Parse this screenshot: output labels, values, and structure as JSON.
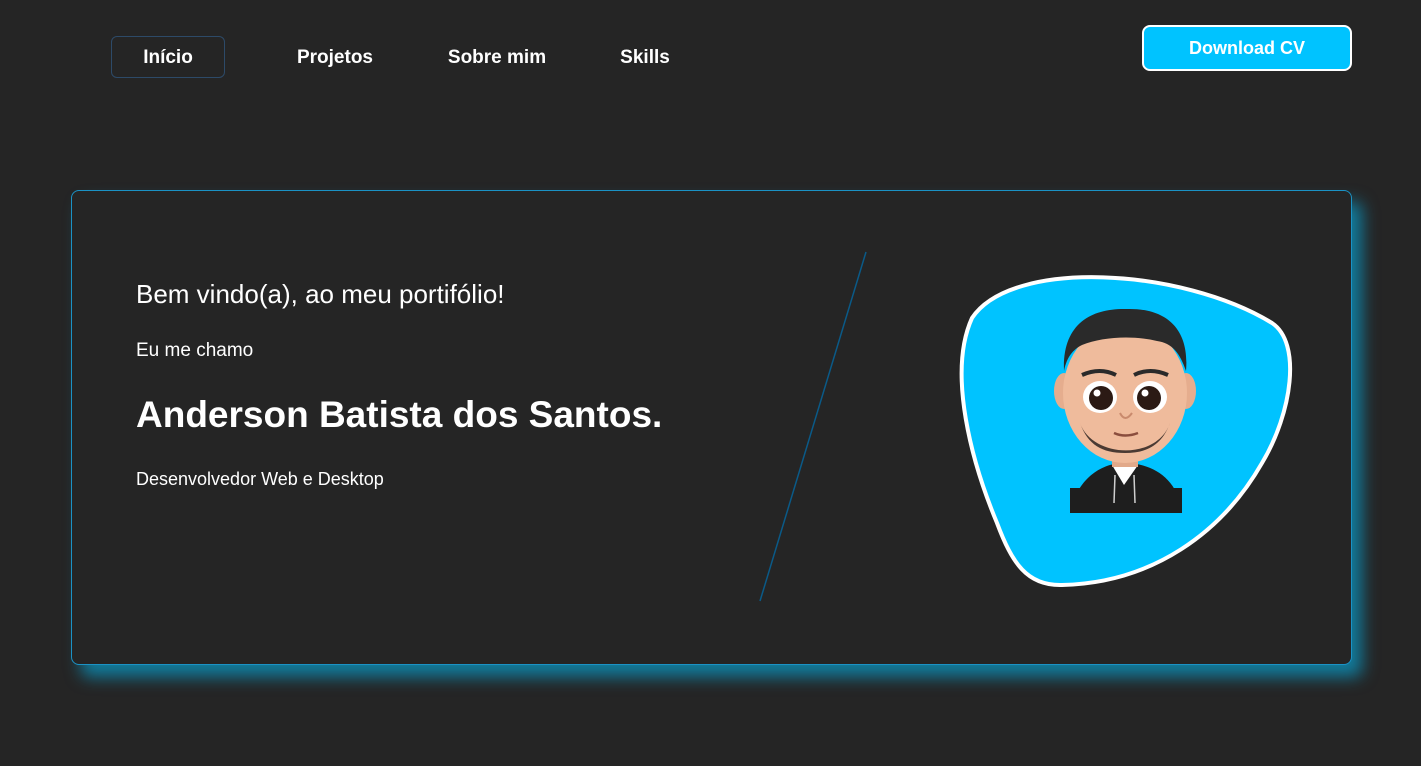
{
  "nav": {
    "items": [
      {
        "label": "Início",
        "active": true
      },
      {
        "label": "Projetos",
        "active": false
      },
      {
        "label": "Sobre mim",
        "active": false
      },
      {
        "label": "Skills",
        "active": false
      }
    ],
    "download_label": "Download CV"
  },
  "hero": {
    "greeting": "Bem vindo(a), ao meu portifólio!",
    "intro": "Eu me chamo",
    "name": "Anderson Batista dos Santos.",
    "role": "Desenvolvedor Web e Desktop",
    "avatar_icon": "avatar-illustration-icon"
  },
  "colors": {
    "background": "#252525",
    "accent": "#00c3ff",
    "text": "#ffffff",
    "card_border": "#1b92c5"
  }
}
